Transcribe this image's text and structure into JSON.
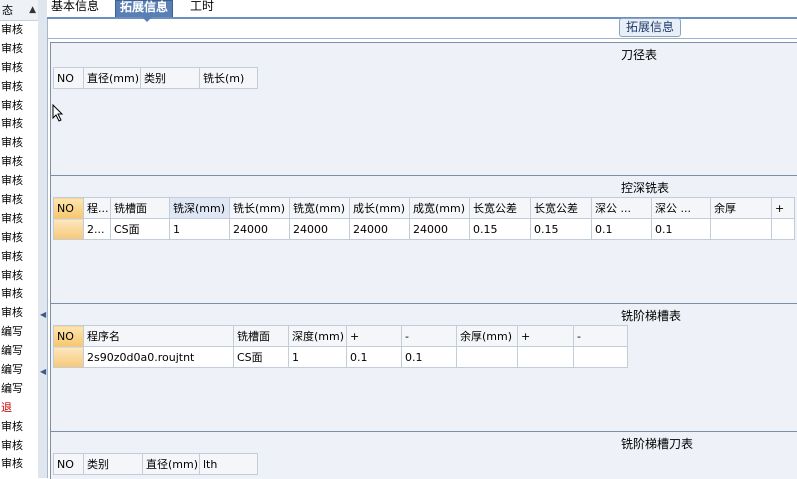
{
  "tabs": [
    {
      "label": "基本信息",
      "active": false
    },
    {
      "label": "拓展信息",
      "active": true
    },
    {
      "label": "工时",
      "active": false
    }
  ],
  "sidebar": {
    "header": "态",
    "items": [
      {
        "label": "审核",
        "red": false
      },
      {
        "label": "审核",
        "red": false
      },
      {
        "label": "审核",
        "red": false
      },
      {
        "label": "审核",
        "red": false
      },
      {
        "label": "审核",
        "red": false
      },
      {
        "label": "审核",
        "red": false
      },
      {
        "label": "审核",
        "red": false
      },
      {
        "label": "审核",
        "red": false
      },
      {
        "label": "审核",
        "red": false
      },
      {
        "label": "审核",
        "red": false
      },
      {
        "label": "审核",
        "red": false
      },
      {
        "label": "审核",
        "red": false
      },
      {
        "label": "审核",
        "red": false
      },
      {
        "label": "审核",
        "red": false
      },
      {
        "label": "审核",
        "red": false
      },
      {
        "label": "审核",
        "red": false
      },
      {
        "label": "编写",
        "red": false
      },
      {
        "label": "编写",
        "red": false
      },
      {
        "label": "编写",
        "red": false
      },
      {
        "label": "编写",
        "red": false
      },
      {
        "label": "退",
        "red": true
      },
      {
        "label": "审核",
        "red": false
      },
      {
        "label": "审核",
        "red": false
      },
      {
        "label": "审核",
        "red": false
      }
    ]
  },
  "group": {
    "title": "拓展信息"
  },
  "sections": {
    "cutter": {
      "title": "刀径表",
      "columns": [
        "NO",
        "直径(mm)",
        "类别",
        "铣长(m)"
      ]
    },
    "deep": {
      "title": "控深铣表",
      "columns": [
        "NO",
        "程...",
        "铣槽面",
        "铣深(mm)",
        "铣长(mm)",
        "铣宽(mm)",
        "成长(mm)",
        "成宽(mm)",
        "长宽公差",
        "长宽公差",
        "深公 ...",
        "深公 ...",
        "余厚",
        "+"
      ],
      "rows": [
        [
          "",
          "2...",
          "CS面",
          "1",
          "24000",
          "24000",
          "24000",
          "24000",
          "0.15",
          "0.15",
          "0.1",
          "0.1",
          "",
          ""
        ]
      ]
    },
    "step": {
      "title": "铣阶梯槽表",
      "columns": [
        "NO",
        "程序名",
        "铣槽面",
        "深度(mm)",
        "+",
        "-",
        "余厚(mm)",
        "+",
        "-"
      ],
      "rows": [
        [
          "",
          "2s90z0d0a0.roujtnt",
          "CS面",
          "1",
          "0.1",
          "0.1",
          "",
          "",
          ""
        ]
      ]
    },
    "stepcutter": {
      "title": "铣阶梯槽刀表",
      "columns": [
        "NO",
        "类别",
        "直径(mm)",
        "lth"
      ]
    }
  }
}
